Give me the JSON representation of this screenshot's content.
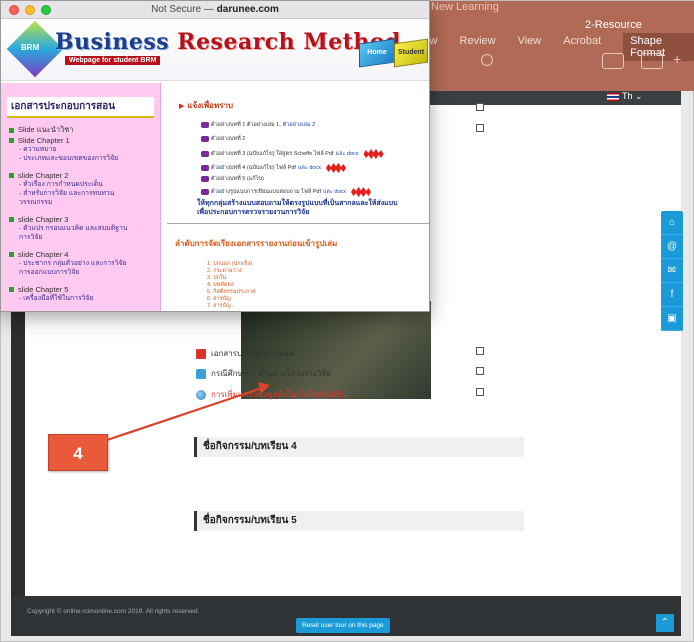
{
  "background_app": {
    "faded_title": "New Learning",
    "resource_label": "2-Resource",
    "menu": [
      "Review",
      "View",
      "Acrobat",
      "Shape Format"
    ],
    "menu_partial": "iew",
    "lang": "Th"
  },
  "popup": {
    "title_prefix": "Not Secure —",
    "title_domain": "darunee.com",
    "banner_main_1": "Business",
    "banner_main_2": "Research Method",
    "banner_sub": "Webpage for student BRM",
    "logo_text": "BRM",
    "home_label": "Home",
    "student_label": "Student"
  },
  "sidebar": {
    "title": "เอกสารประกอบการสอน",
    "groups": [
      {
        "head": "Slide แนะนำวิชา",
        "lines": []
      },
      {
        "head": "Slide Chapter 1",
        "lines": [
          "- ความหมาย",
          "- ประเภทและขอบเขตของการวิจัย"
        ]
      },
      {
        "head": "slide Chapter 2",
        "lines": [
          "- หัวเรื่อง การกำหนดประเด็น",
          "- สำหรับการวิจัย และการทบทวน",
          "  วรรณกรรม"
        ]
      },
      {
        "head": "slide Chapter 3",
        "lines": [
          "- ตัวแปร กรอบแนวคิด และสมมติฐาน",
          "  การวิจัย"
        ]
      },
      {
        "head": "slide Chapter 4",
        "lines": [
          "- ประชากร กลุ่มตัวอย่าง และการวิจัย",
          "  การออกแบบการวิจัย"
        ]
      },
      {
        "head": "slide Chapter 5",
        "lines": [
          "- เครื่องมือที่ใช้ในการวิจัย"
        ]
      }
    ]
  },
  "content": {
    "notice": "แจ้งเพื่อทราบ",
    "examples": [
      {
        "text": "ตัวอย่างบทที่ 1 ตัวอย่างเล่ม 1,",
        "blue": "ตัวอย่างเล่ม 2",
        "new": false
      },
      {
        "text": "ตัวอย่างบทที่ 2",
        "blue": "",
        "new": false
      },
      {
        "text": "ตัวอย่างบทที่ 3 (ฉบับแก้ไข) ใส่สูตร Scheffe ไฟล์ Pdf",
        "blue": "และ docx",
        "new": true
      },
      {
        "text": "ตัวอย่างบทที่ 4 (ฉบับแก้ไข) ไฟล์ Pdf",
        "blue": "และ docx",
        "new": true
      },
      {
        "text": "ตัวอย่างบทที่ 5 (แก้ไข)",
        "blue": "",
        "new": false
      },
      {
        "text": "ตัวอย่างรูปแบบการเขียนแบบสอบถาม ไฟล์ Pdf",
        "blue": "และ docx",
        "new": true
      }
    ],
    "big_note_1": "ให้ทุกกลุ่มสร้างแบบสอบถามให้ตรงรูปแบบที่เป็นสากลและให้ส่งแบบ",
    "big_note_2": "เพื่อประกอบการตรวจรายงานการวิจัย",
    "order_title": "ลำดับการจัดเรียงเอกสารรายงานก่อนเข้ารูปเล่ม",
    "order_list": [
      "1. ปกนอก (ปกแข็ง)",
      "2. กระดาษว่าง",
      "3. ปกใน",
      "4. บทคัดย่อ",
      "5. กิตติกรรมประกาศ",
      "6. สารบัญ",
      "7. สารบัญ..."
    ]
  },
  "page": {
    "resources": [
      {
        "label": "เอกสารประกอบการสอน",
        "icon": "book-icon"
      },
      {
        "label": "กรณีศึกษา- 1 ตัวอย่างโครงร่างวิจัย",
        "icon": "folder-icon"
      },
      {
        "label": "การเพิ่มแหล่งข้อมูลที่เป็นเว็บไซต์ (URL)",
        "icon": "url-globe-icon"
      }
    ],
    "sections": [
      "ชื่อกิจกรรม/บทเรียน 4",
      "ชื่อกิจกรรม/บทเรียน 5"
    ],
    "footer_copy": "Copyright © online.rcimonline.com 2019. All rights reserved.",
    "tour_button": "Reset user tour on this page",
    "callout_number": "4"
  },
  "colors": {
    "accent": "#1a9bd7",
    "topbar": "#b06a55",
    "callout": "#e85a3a",
    "sidebar": "#ffc9f0"
  }
}
